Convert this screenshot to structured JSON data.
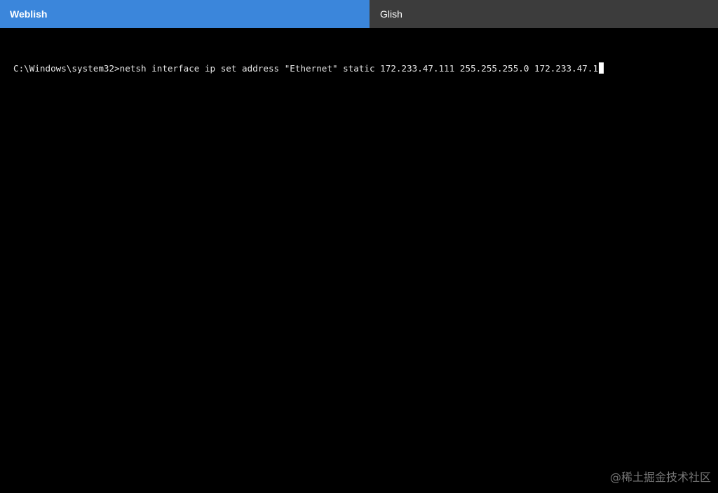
{
  "tabs": [
    {
      "label": "Weblish",
      "active": true
    },
    {
      "label": "Glish",
      "active": false
    }
  ],
  "terminal": {
    "prompt": "C:\\Windows\\system32>",
    "command": "netsh interface ip set address \"Ethernet\" static 172.233.47.111 255.255.255.0 172.233.47.1"
  },
  "watermark": "@稀土掘金技术社区",
  "colors": {
    "active_tab": "#3b86db",
    "inactive_tab": "#3c3c3c",
    "terminal_bg": "#000000",
    "terminal_text": "#e8e8e8"
  }
}
